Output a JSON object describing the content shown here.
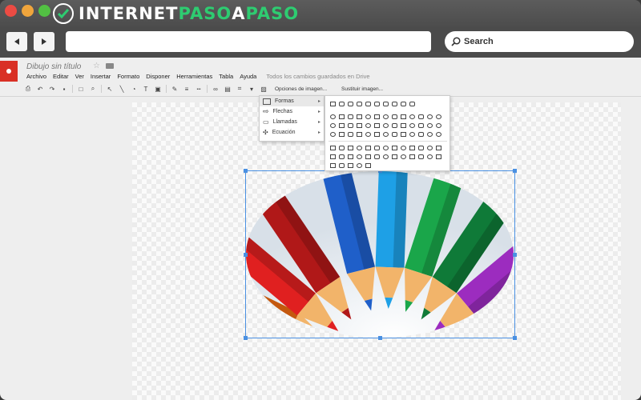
{
  "brand": {
    "part_a": "INTERNET",
    "part_b": "PASO",
    "part_c": "A",
    "part_d": "PASO"
  },
  "search": {
    "label": "Search"
  },
  "doc": {
    "title": "Dibujo sin título",
    "menus": [
      "Archivo",
      "Editar",
      "Ver",
      "Insertar",
      "Formato",
      "Disponer",
      "Herramientas",
      "Tabla",
      "Ayuda"
    ],
    "saved_status": "Todos los cambios guardados en Drive"
  },
  "toolbar": {
    "image_options_label": "Opciones de imagen...",
    "replace_image_label": "Sustituir imagen..."
  },
  "shape_menu": {
    "items": [
      {
        "label": "Formas"
      },
      {
        "label": "Flechas"
      },
      {
        "label": "Llamadas"
      },
      {
        "label": "Ecuación"
      }
    ]
  },
  "colors": {
    "accent": "#4a90e2",
    "brand_green": "#2ecc71",
    "doc_red": "#d93025"
  }
}
